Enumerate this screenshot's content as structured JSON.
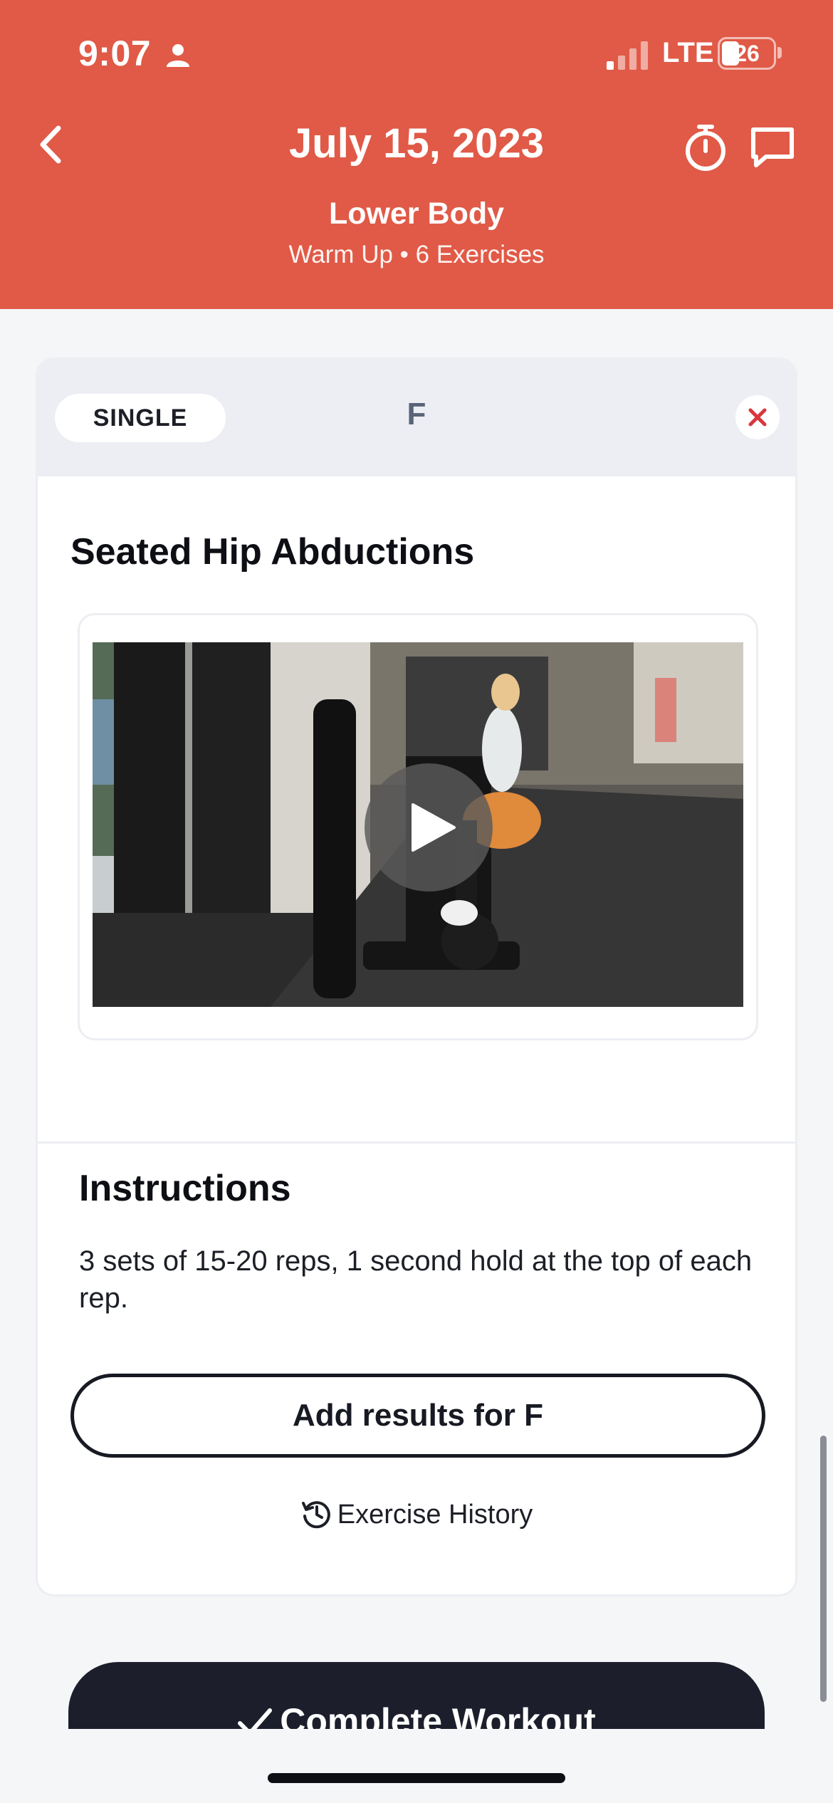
{
  "status_bar": {
    "time": "9:07",
    "carrier": "LTE",
    "battery_level": "26"
  },
  "header": {
    "title": "July 15, 2023",
    "subtitle": "Lower Body",
    "meta": "Warm Up • 6 Exercises",
    "back_icon": "chevron-left-icon",
    "timer_icon": "stopwatch-icon",
    "chat_icon": "chat-bubble-icon",
    "background_color": "#e05a47"
  },
  "exercise_card": {
    "type_label": "SINGLE",
    "letter": "F",
    "close_icon": "close-icon",
    "close_color": "#d9363e",
    "exercise_name": "Seated Hip Abductions",
    "video": {
      "play_icon": "play-icon"
    },
    "instructions_title": "Instructions",
    "instructions_text": "3 sets of 15-20 reps, 1 second hold at the top of each rep.",
    "add_results_label": "Add results for F",
    "history_label": "Exercise History",
    "history_icon": "history-clock-icon"
  },
  "footer": {
    "complete_label": "Complete Workout",
    "complete_icon": "checkmark-icon",
    "button_color": "#1c1f2b"
  }
}
